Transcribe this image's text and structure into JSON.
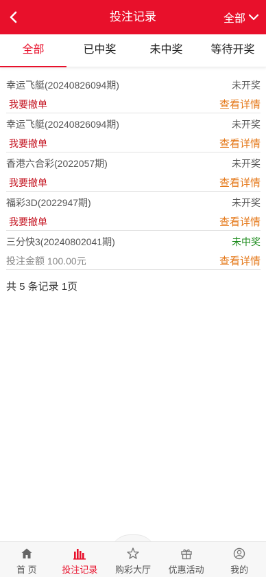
{
  "header": {
    "title": "投注记录",
    "filter_label": "全部"
  },
  "tabs": [
    {
      "label": "全部"
    },
    {
      "label": "已中奖"
    },
    {
      "label": "未中奖"
    },
    {
      "label": "等待开奖"
    }
  ],
  "records": [
    {
      "name": "幸运飞艇(20240826094期)",
      "status": "未开奖",
      "action": "我要撤单",
      "detail": "查看详情"
    },
    {
      "name": "幸运飞艇(20240826094期)",
      "status": "未开奖",
      "action": "我要撤单",
      "detail": "查看详情"
    },
    {
      "name": "香港六合彩(2022057期)",
      "status": "未开奖",
      "action": "我要撤单",
      "detail": "查看详情"
    },
    {
      "name": "福彩3D(2022947期)",
      "status": "未开奖",
      "action": "我要撤单",
      "detail": "查看详情"
    },
    {
      "name": "三分快3(20240802041期)",
      "status": "未中奖",
      "amount": "投注金额 100.00元",
      "detail": "查看详情"
    }
  ],
  "summary": "共 5 条记录 1页",
  "bottom_nav": [
    {
      "label": "首 页",
      "icon": "home-icon"
    },
    {
      "label": "投注记录",
      "icon": "bar-chart-icon"
    },
    {
      "label": "购彩大厅",
      "icon": "star-icon"
    },
    {
      "label": "优惠活动",
      "icon": "gift-icon"
    },
    {
      "label": "我的",
      "icon": "user-icon"
    }
  ],
  "colors": {
    "brand_red": "#e8102b",
    "detail_orange": "#e57a1c",
    "lost_green": "#1a8a1a"
  }
}
